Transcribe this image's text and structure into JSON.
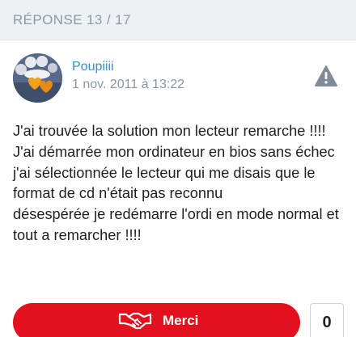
{
  "header": {
    "reply_counter": "RÉPONSE 13 / 17"
  },
  "post": {
    "author": "Poupiiii",
    "date": "1 nov. 2011 à 13:22",
    "avatar_icon": "hearts-avatar",
    "report_icon": "warning-triangle-icon",
    "body_lines": [
      "J'ai trouvée la solution mon lecteur remarche !!!!",
      "J'ai démarrée mon ordinateur en bios sans échec",
      "j'ai sélectionnée le lecteur qui me disais que le format de cd n'était pas reconnu",
      "désespérée je redémarre l'ordi en mode normal et tout a remarcher !!!!"
    ]
  },
  "actions": {
    "merci_label": "Merci",
    "merci_count": "0",
    "merci_icon": "handshake-icon"
  },
  "colors": {
    "accent_red": "#e2111d",
    "author_blue": "#3a8fc4",
    "header_bg": "#eef1f4",
    "muted_text": "#8a96a3"
  }
}
